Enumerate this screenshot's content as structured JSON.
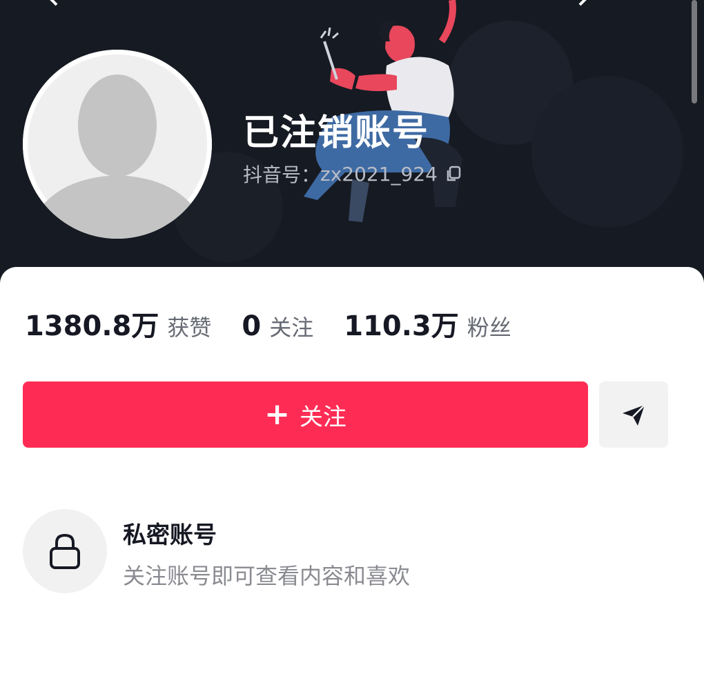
{
  "profile": {
    "name": "已注销账号",
    "uid_label": "抖音号：",
    "uid_value": "zx2021_924"
  },
  "stats": {
    "likes_value": "1380.8万",
    "likes_label": "获赞",
    "following_value": "0",
    "following_label": "关注",
    "followers_value": "110.3万",
    "followers_label": "粉丝"
  },
  "actions": {
    "follow_icon": "+",
    "follow_label": "关注",
    "share_icon": "send-icon"
  },
  "private_notice": {
    "title": "私密账号",
    "description": "关注账号即可查看内容和喜欢",
    "icon": "lock-icon"
  },
  "colors": {
    "header_bg": "#161a22",
    "accent": "#fe2c55",
    "text_primary": "#161823",
    "text_secondary": "#8a8b91"
  }
}
